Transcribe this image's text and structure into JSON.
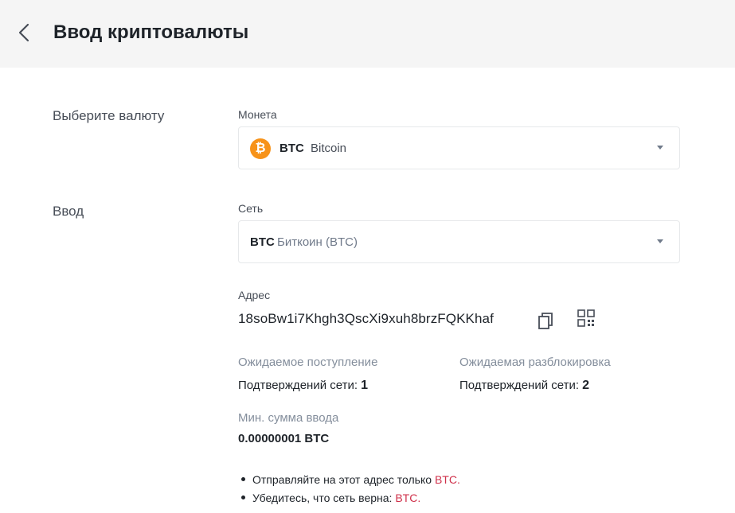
{
  "header": {
    "title": "Ввод криптовалюты",
    "back_icon": "chevron-left-icon"
  },
  "sections": {
    "select_currency_label": "Выберите валюту",
    "deposit_label": "Ввод"
  },
  "coin": {
    "label": "Монета",
    "icon": "bitcoin-icon",
    "icon_color": "#f7931a",
    "code": "BTC",
    "name": "Bitcoin"
  },
  "network": {
    "label": "Сеть",
    "code": "BTC",
    "name": "Биткоин (BTC)"
  },
  "address": {
    "label": "Адрес",
    "value": "18soBw1i7Khgh3QscXi9xuh8brzFQKKhaf",
    "copy_icon": "copy-icon",
    "qr_icon": "qr-code-icon"
  },
  "expected_arrival": {
    "label": "Ожидаемое поступление",
    "text": "Подтверждений сети:",
    "value": "1"
  },
  "expected_unlock": {
    "label": "Ожидаемая разблокировка",
    "text": "Подтверждений сети:",
    "value": "2"
  },
  "min_deposit": {
    "label": "Мин. сумма ввода",
    "value": "0.00000001 BTC"
  },
  "notes": [
    {
      "text": "Отправляйте на этот адрес только",
      "highlight": "BTC",
      "suffix": "."
    },
    {
      "text": "Убедитесь, что сеть верна:",
      "highlight": "BTC",
      "suffix": "."
    }
  ],
  "colors": {
    "highlight": "#cf304a",
    "header_bg": "#f5f5f5"
  }
}
